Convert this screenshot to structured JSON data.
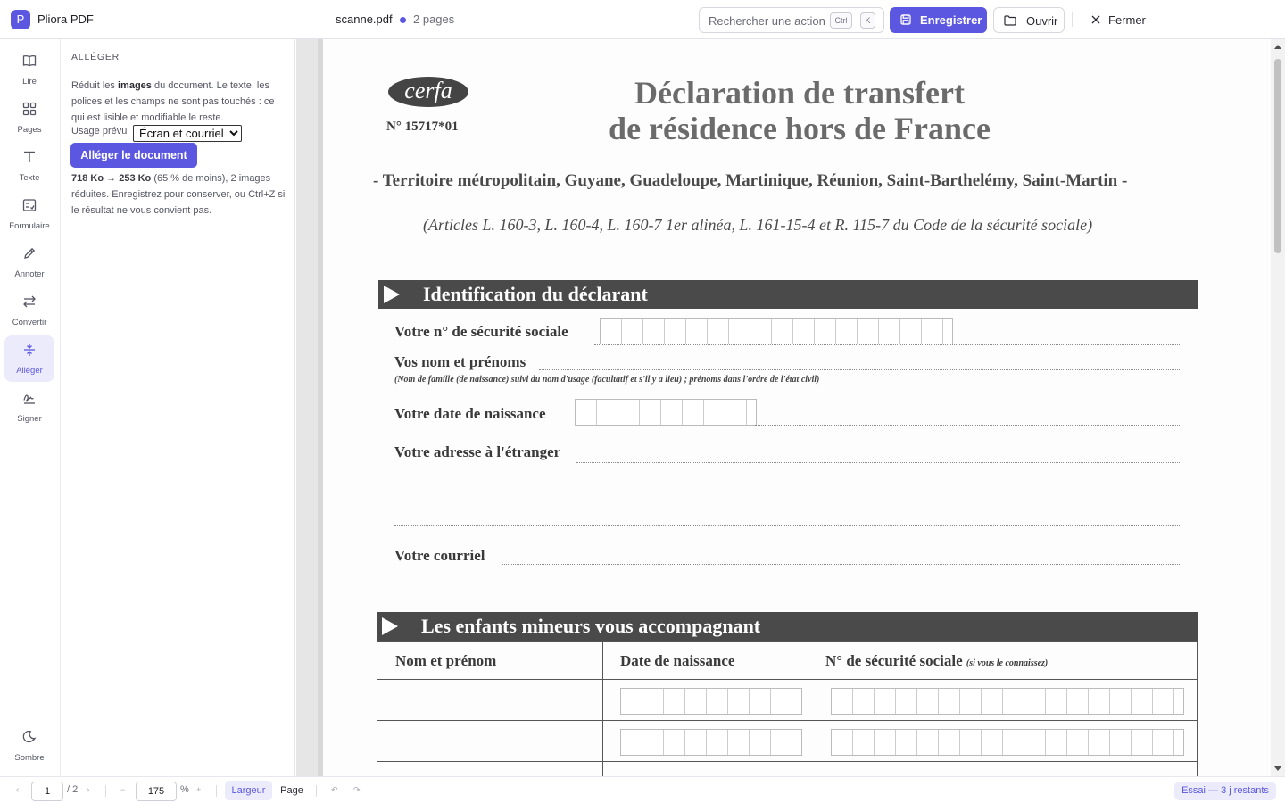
{
  "header": {
    "logo_letter": "P",
    "app_name": "Pliora PDF",
    "file_name": "scanne.pdf",
    "page_count": "2 pages",
    "search_placeholder": "Rechercher une action",
    "shortcut_keys": [
      "Ctrl",
      "K"
    ],
    "save_label": "Enregistrer",
    "open_label": "Ouvrir",
    "close_label": "Fermer"
  },
  "rail": {
    "items": [
      {
        "label": "Lire",
        "icon": "book-icon"
      },
      {
        "label": "Pages",
        "icon": "grid-icon"
      },
      {
        "label": "Texte",
        "icon": "text-icon"
      },
      {
        "label": "Formulaire",
        "icon": "form-icon"
      },
      {
        "label": "Annoter",
        "icon": "pen-icon"
      },
      {
        "label": "Convertir",
        "icon": "swap-icon"
      },
      {
        "label": "Alléger",
        "icon": "compress-icon",
        "active": true
      },
      {
        "label": "Signer",
        "icon": "signature-icon"
      }
    ],
    "dark_mode_label": "Sombre"
  },
  "panel": {
    "title": "ALLÉGER",
    "desc_before": "Réduit les ",
    "desc_bold": "images",
    "desc_after": " du document. Le texte, les polices et les champs ne sont pas touchés : ce qui est lisible et modifiable le reste.",
    "usage_label": "Usage prévu",
    "usage_value": "Écran et courriel",
    "compress_button": "Alléger le document",
    "result_size_before": "718 Ko",
    "result_arrow": "→",
    "result_size_after": "253 Ko",
    "result_rest": " (65 % de moins), 2 images réduites. Enregistrez pour conserver, ou Ctrl+Z si le résultat ne vous convient pas."
  },
  "document": {
    "cerfa_logo": "cerfa",
    "form_number": "N° 15717*01",
    "title_line1": "Déclaration de transfert",
    "title_line2": "de résidence hors de France",
    "territory": "- Territoire métropolitain, Guyane, Guadeloupe, Martinique, Réunion, Saint-Barthelémy, Saint-Martin -",
    "articles": "(Articles L. 160-3, L. 160-4, L. 160-7 1er alinéa, L. 161-15-4 et R. 115-7 du Code de la sécurité sociale)",
    "section1": "Identification du déclarant",
    "field_ssn": "Votre n° de sécurité sociale",
    "field_name": "Vos nom et prénoms",
    "field_name_sub": "(Nom de famille (de naissance) suivi du nom d'usage (facultatif et s'il y a lieu) ; prénoms dans l'ordre de l'état civil)",
    "field_birth": "Votre date de naissance",
    "field_address": "Votre adresse à l'étranger",
    "field_email": "Votre courriel",
    "section2": "Les enfants mineurs vous accompagnant",
    "col_name": "Nom et prénom",
    "col_birth": "Date de naissance",
    "col_ssn": "N° de sécurité sociale",
    "col_ssn_note": "(si vous le connaissez)"
  },
  "footer": {
    "current_page": "1",
    "total_pages": "/ 2",
    "zoom": "175",
    "zoom_unit": "%",
    "fit_width": "Largeur",
    "fit_page": "Page",
    "trial": "Essai — 3 j restants"
  },
  "colors": {
    "accent": "#5b57e0",
    "accent_soft": "#ecebfb"
  }
}
